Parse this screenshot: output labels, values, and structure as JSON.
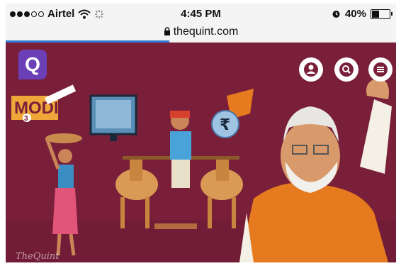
{
  "status_bar": {
    "carrier": "Airtel",
    "time": "4:45 PM",
    "battery": "40%",
    "battery_level": 0.4
  },
  "url_bar": {
    "domain": "thequint.com",
    "load_progress": 0.42
  },
  "hero": {
    "badge_text": "MODI",
    "badge_number": "3",
    "watermark": "TheQuint",
    "currency_symbol": "₹"
  },
  "header": {
    "logo_letter": "Q"
  },
  "icons": [
    "signal-icon",
    "wifi-icon",
    "activity-icon",
    "lock-icon",
    "alarm-icon",
    "battery-icon",
    "quint-logo-icon",
    "user-icon",
    "search-icon",
    "menu-icon"
  ],
  "colors": {
    "background": "#7a1f3a",
    "accent": "#2f7bd6",
    "logo": "#6b3fb5",
    "saffron": "#e67a1e"
  }
}
